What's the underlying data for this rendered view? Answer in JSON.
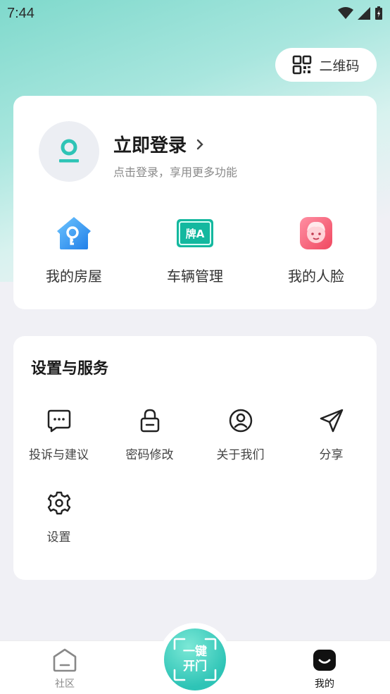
{
  "status_bar": {
    "time": "7:44"
  },
  "header": {
    "qr_label": "二维码"
  },
  "profile": {
    "login_title": "立即登录",
    "login_subtitle": "点击登录，享用更多功能",
    "quick_items": [
      {
        "label": "我的房屋",
        "icon": "house-key-icon"
      },
      {
        "label": "车辆管理",
        "icon": "license-plate-icon"
      },
      {
        "label": "我的人脸",
        "icon": "face-icon"
      }
    ]
  },
  "services": {
    "title": "设置与服务",
    "items": [
      {
        "label": "投诉与建议",
        "icon": "message-icon"
      },
      {
        "label": "密码修改",
        "icon": "lock-icon"
      },
      {
        "label": "关于我们",
        "icon": "user-circle-icon"
      },
      {
        "label": "分享",
        "icon": "send-icon"
      },
      {
        "label": "设置",
        "icon": "gear-icon"
      }
    ]
  },
  "bottom_nav": {
    "community_label": "社区",
    "open_door_label": "一键开门",
    "mine_label": "我的"
  },
  "colors": {
    "accent": "#2ec4b6",
    "background": "#f0f0f5"
  }
}
